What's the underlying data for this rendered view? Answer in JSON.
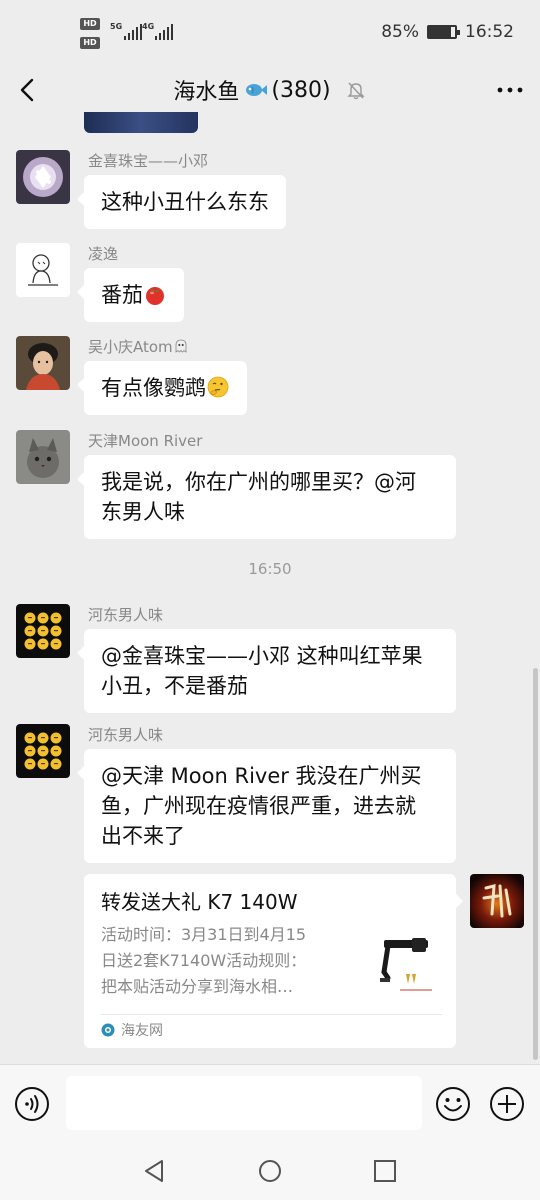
{
  "status_bar": {
    "network_badges": [
      "HD",
      "HD"
    ],
    "network_types": [
      "5G",
      "4G"
    ],
    "battery": "85%",
    "battery_level": 0.85,
    "time": "16:52"
  },
  "nav": {
    "title_prefix": "海水鱼",
    "title_icon": "fish-icon",
    "member_count": "(380)",
    "muted_icon": "bell-off-icon",
    "back_icon": "chevron-left-icon",
    "more_icon": "more-dots-icon"
  },
  "messages": [
    {
      "sender": "金喜珠宝——小邓",
      "text": "这种小丑什么东东",
      "avatar": "ring-avatar"
    },
    {
      "sender": "凌逸",
      "text": "番茄",
      "emoji": "tomato-emoji",
      "avatar": "sketch-avatar"
    },
    {
      "sender": "吴小庆Atom",
      "sender_emoji": "ghost-emoji",
      "text": "有点像鹦鹉",
      "emoji": "thinking-emoji",
      "avatar": "boy-avatar"
    },
    {
      "sender": "天津Moon River",
      "text_lines": [
        "我是说，你在广州的哪里买？@河",
        "东男人味"
      ],
      "avatar": "cat-avatar"
    },
    {
      "sender": "河东男人味",
      "text_lines": [
        "@金喜珠宝——小邓  这种叫红苹果",
        "小丑，不是番茄"
      ],
      "avatar": "emoji-grid-avatar"
    },
    {
      "sender": "河东男人味",
      "text_lines": [
        "@天津 Moon River  我没在广州买",
        "鱼，广州现在疫情很严重，进去就",
        "出不来了"
      ],
      "avatar": "emoji-grid-avatar"
    }
  ],
  "timestamp": "16:50",
  "link_card": {
    "title": "转发送大礼 K7 140W",
    "desc_lines": [
      "活动时间：3月31日到4月15",
      "日送2套K7140W活动规则：",
      "把本贴活动分享到海水相…"
    ],
    "source": "海友网",
    "thumb_icon": "aquarium-lamp-icon",
    "self_avatar": "calligraphy-avatar"
  },
  "input_bar": {
    "voice_icon": "voice-icon",
    "emoji_icon": "smiley-icon",
    "plus_icon": "plus-circle-icon",
    "input_value": ""
  },
  "system_nav": {
    "back": "triangle-back-icon",
    "home": "circle-home-icon",
    "recents": "square-recents-icon"
  }
}
